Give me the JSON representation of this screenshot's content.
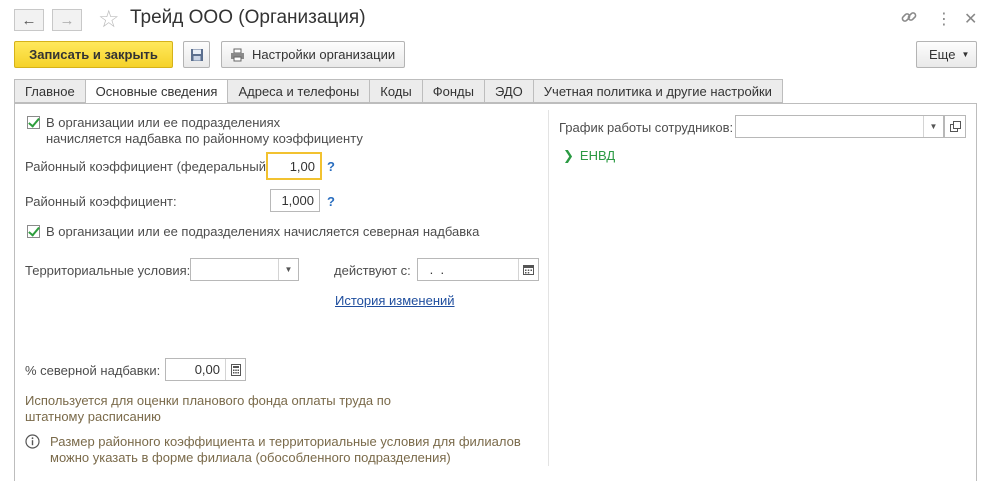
{
  "window": {
    "title": "Трейд ООО (Организация)"
  },
  "toolbar": {
    "save_close_label": "Записать и закрыть",
    "org_settings_label": "Настройки организации",
    "more_label": "Еще"
  },
  "tabs": [
    {
      "label": "Главное",
      "active": false
    },
    {
      "label": "Основные сведения",
      "active": true
    },
    {
      "label": "Адреса и телефоны",
      "active": false
    },
    {
      "label": "Коды",
      "active": false
    },
    {
      "label": "Фонды",
      "active": false
    },
    {
      "label": "ЭДО",
      "active": false
    },
    {
      "label": "Учетная политика и другие настройки",
      "active": false
    }
  ],
  "left": {
    "regional_checkbox_line1": "В организации или ее подразделениях",
    "regional_checkbox_line2": "начисляется надбавка по районному коэффициенту",
    "regional_checked": true,
    "federal_coef_label": "Районный коэффициент (федеральный):",
    "federal_coef_value": "1,00",
    "regional_coef_label": "Районный коэффициент:",
    "regional_coef_value": "1,000",
    "help_mark": "?",
    "north_checkbox_label": "В организации или ее подразделениях начисляется северная надбавка",
    "north_checked": true,
    "territorial_label": "Территориальные условия:",
    "territorial_value": "",
    "valid_from_label": "действуют с:",
    "valid_from_value": " .  .",
    "history_link": "История изменений",
    "north_percent_label": "% северной надбавки:",
    "north_percent_value": "0,00",
    "hint1_line1": "Используется для оценки планового фонда оплаты труда по",
    "hint1_line2": "штатному расписанию",
    "hint2_line1": "Размер районного коэффициента и территориальные условия для филиалов",
    "hint2_line2": "можно указать в форме филиала (обособленного подразделения)"
  },
  "right": {
    "schedule_label": "График работы сотрудников:",
    "schedule_value": "",
    "envd_label": "ЕНВД"
  }
}
